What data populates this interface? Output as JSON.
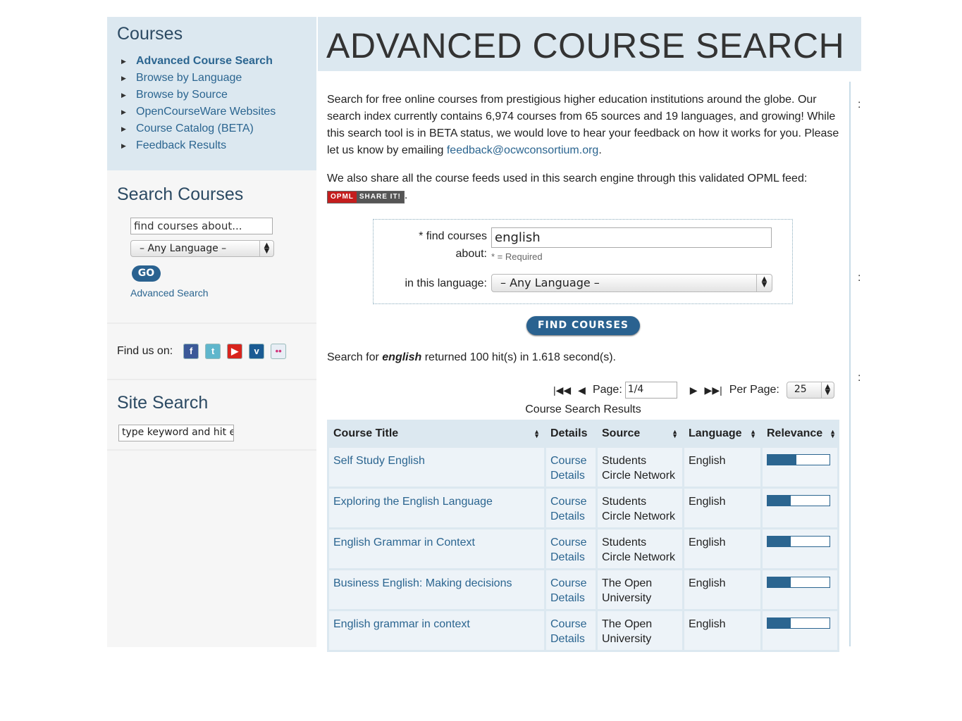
{
  "sidebar": {
    "courses_heading": "Courses",
    "nav": [
      {
        "label": "Advanced Course Search",
        "active": true
      },
      {
        "label": "Browse by Language",
        "active": false
      },
      {
        "label": "Browse by Source",
        "active": false
      },
      {
        "label": "OpenCourseWare Websites",
        "active": false
      },
      {
        "label": "Course Catalog (BETA)",
        "active": false
      },
      {
        "label": "Feedback Results",
        "active": false
      }
    ],
    "search_heading": "Search Courses",
    "search_value": "find courses about...",
    "language_value": "– Any Language –",
    "go_label": "GO",
    "advanced_link": "Advanced Search",
    "find_us_label": "Find us on:",
    "social": [
      {
        "icon": "facebook-icon",
        "glyph": "f",
        "color": "#3b5998"
      },
      {
        "icon": "twitter-icon",
        "glyph": "t",
        "color": "#5fb6cc"
      },
      {
        "icon": "youtube-icon",
        "glyph": "▶",
        "color": "#d8241d"
      },
      {
        "icon": "vimeo-icon",
        "glyph": "v",
        "color": "#1a5b93"
      },
      {
        "icon": "flickr-icon",
        "glyph": "••",
        "color": "#e8eef5"
      }
    ],
    "site_search_heading": "Site Search",
    "site_search_value": "type keyword and hit e"
  },
  "header": {
    "title": "ADVANCED COURSE SEARCH"
  },
  "intro": {
    "text": "Search for free online courses from prestigious higher education institutions around the globe. Our search index currently contains 6,974 courses from 65 sources and 19 languages, and growing! While this search tool is in BETA status, we would love to hear your feedback on how it works for you. Please let us know by emailing ",
    "email": "feedback@ocwconsortium.org",
    "email_suffix": ".",
    "opml_text": "We also share all the course feeds used in this search engine through this validated OPML feed:",
    "opml_badge_left": "OPML",
    "opml_badge_right": "SHARE IT!",
    "opml_suffix": "."
  },
  "form": {
    "find_label": "* find courses",
    "find_label2": "about:",
    "find_value": "english",
    "required_note": "* = Required",
    "language_label": "in this language:",
    "language_value": "– Any Language –",
    "submit_label": "FIND COURSES"
  },
  "summary": {
    "prefix": "Search for ",
    "term": "english",
    "suffix": " returned 100 hit(s) in 1.618 second(s)."
  },
  "pager": {
    "page_label": "Page:",
    "page_value": "1/4",
    "per_page_label": "Per Page:",
    "per_page_value": "25"
  },
  "results": {
    "caption": "Course Search Results",
    "columns": [
      "Course Title",
      "Details",
      "Source",
      "Language",
      "Relevance"
    ],
    "rows": [
      {
        "title": "Self Study English",
        "details1": "Course",
        "details2": "Details",
        "source1": "Students",
        "source2": "Circle Network",
        "language": "English",
        "relevance": 0.47
      },
      {
        "title": "Exploring the English Language",
        "details1": "Course",
        "details2": "Details",
        "source1": "Students",
        "source2": "Circle Network",
        "language": "English",
        "relevance": 0.38
      },
      {
        "title": "English Grammar in Context",
        "details1": "Course",
        "details2": "Details",
        "source1": "Students",
        "source2": "Circle Network",
        "language": "English",
        "relevance": 0.38
      },
      {
        "title": "Business English: Making decisions",
        "details1": "Course",
        "details2": "Details",
        "source1": "The Open",
        "source2": "University",
        "language": "English",
        "relevance": 0.38
      },
      {
        "title": "English grammar in context",
        "details1": "Course",
        "details2": "Details",
        "source1": "The Open",
        "source2": "University",
        "language": "English",
        "relevance": 0.38
      }
    ]
  }
}
